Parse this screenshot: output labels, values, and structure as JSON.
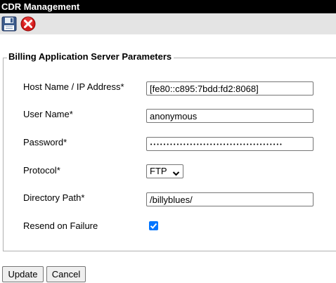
{
  "window": {
    "title": "CDR Management"
  },
  "toolbar": {
    "save_icon": "floppy-disk-icon",
    "cancel_icon": "red-x-circle-icon"
  },
  "section": {
    "legend": "Billing Application Server Parameters"
  },
  "form": {
    "host": {
      "label": "Host Name / IP Address*",
      "value": "[fe80::c895:7bdd:fd2:8068]"
    },
    "username": {
      "label": "User Name*",
      "value": "anonymous"
    },
    "password": {
      "label": "Password*",
      "value": "••••••••••••••••••••••••••••••••••••••••"
    },
    "protocol": {
      "label": "Protocol*",
      "value": "FTP"
    },
    "directory": {
      "label": "Directory Path*",
      "value": "/billyblues/"
    },
    "resend": {
      "label": "Resend on Failure",
      "checked": true
    }
  },
  "buttons": {
    "update_label": "Update",
    "cancel_label": "Cancel"
  },
  "colors": {
    "titlebar": "#000000",
    "toolbar": "#e4e4e4",
    "checkbox": "#0075ff"
  }
}
